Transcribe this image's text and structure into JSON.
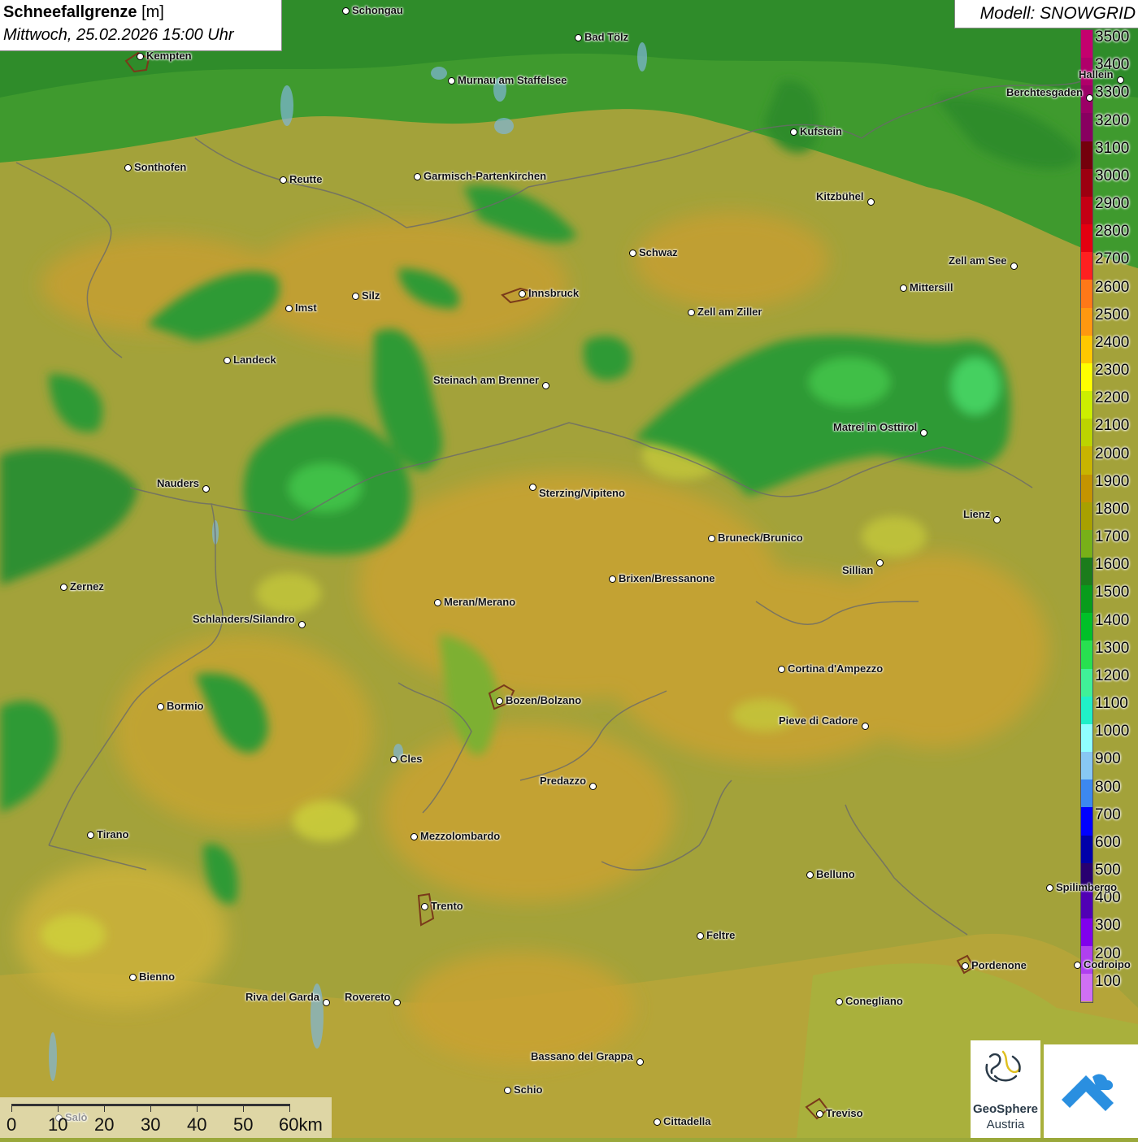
{
  "title": {
    "main": "Schneefallgrenze",
    "unit": "[m]",
    "datetime": "Mittwoch, 25.02.2026 15:00 Uhr"
  },
  "model": "Modell: SNOWGRID",
  "legend": {
    "steps": [
      {
        "label": "3500",
        "color": "#c4006e"
      },
      {
        "label": "3400",
        "color": "#b0006a"
      },
      {
        "label": "3300",
        "color": "#9c0066"
      },
      {
        "label": "3200",
        "color": "#880060"
      },
      {
        "label": "3100",
        "color": "#74000c"
      },
      {
        "label": "3000",
        "color": "#9c0010"
      },
      {
        "label": "2900",
        "color": "#c40014"
      },
      {
        "label": "2800",
        "color": "#e40010"
      },
      {
        "label": "2700",
        "color": "#ff2020"
      },
      {
        "label": "2600",
        "color": "#ff7818"
      },
      {
        "label": "2500",
        "color": "#ff9810"
      },
      {
        "label": "2400",
        "color": "#ffc800"
      },
      {
        "label": "2300",
        "color": "#ffff00"
      },
      {
        "label": "2200",
        "color": "#ccee00"
      },
      {
        "label": "2100",
        "color": "#bcd400"
      },
      {
        "label": "2000",
        "color": "#c8b400"
      },
      {
        "label": "1900",
        "color": "#c49400"
      },
      {
        "label": "1800",
        "color": "#a8a000"
      },
      {
        "label": "1700",
        "color": "#78b018"
      },
      {
        "label": "1600",
        "color": "#1c7c1c"
      },
      {
        "label": "1500",
        "color": "#089c1c"
      },
      {
        "label": "1400",
        "color": "#00c028"
      },
      {
        "label": "1300",
        "color": "#28e050"
      },
      {
        "label": "1200",
        "color": "#40f098"
      },
      {
        "label": "1100",
        "color": "#20f0c8"
      },
      {
        "label": "1000",
        "color": "#90ffff"
      },
      {
        "label": "900",
        "color": "#88c8f4"
      },
      {
        "label": "800",
        "color": "#3c88f0"
      },
      {
        "label": "700",
        "color": "#0000ff"
      },
      {
        "label": "600",
        "color": "#0000a8"
      },
      {
        "label": "500",
        "color": "#280070"
      },
      {
        "label": "400",
        "color": "#5000b4"
      },
      {
        "label": "300",
        "color": "#8000ec"
      },
      {
        "label": "200",
        "color": "#b040f0"
      },
      {
        "label": "100",
        "color": "#d070f4"
      }
    ]
  },
  "cities": [
    {
      "name": "Schongau"
    },
    {
      "name": "Kempten"
    },
    {
      "name": "Bad Tölz"
    },
    {
      "name": "Murnau am Staffelsee"
    },
    {
      "name": "Hallein"
    },
    {
      "name": "Berchtesgaden"
    },
    {
      "name": "Kufstein"
    },
    {
      "name": "Sonthofen"
    },
    {
      "name": "Reutte"
    },
    {
      "name": "Garmisch-Partenkirchen"
    },
    {
      "name": "Kitzbühel"
    },
    {
      "name": "Schwaz"
    },
    {
      "name": "Zell am See"
    },
    {
      "name": "Innsbruck"
    },
    {
      "name": "Mittersill"
    },
    {
      "name": "Imst"
    },
    {
      "name": "Silz"
    },
    {
      "name": "Zell am Ziller"
    },
    {
      "name": "Landeck"
    },
    {
      "name": "Steinach am Brenner"
    },
    {
      "name": "Matrei in Osttirol"
    },
    {
      "name": "Nauders"
    },
    {
      "name": "Sterzing/Vipiteno"
    },
    {
      "name": "Lienz"
    },
    {
      "name": "Bruneck/Brunico"
    },
    {
      "name": "Sillian"
    },
    {
      "name": "Zernez"
    },
    {
      "name": "Brixen/Bressanone"
    },
    {
      "name": "Meran/Merano"
    },
    {
      "name": "Schlanders/Silandro"
    },
    {
      "name": "Cortina d'Ampezzo"
    },
    {
      "name": "Bozen/Bolzano"
    },
    {
      "name": "Bormio"
    },
    {
      "name": "Pieve di Cadore"
    },
    {
      "name": "Cles"
    },
    {
      "name": "Predazzo"
    },
    {
      "name": "Tirano"
    },
    {
      "name": "Mezzolombardo"
    },
    {
      "name": "Belluno"
    },
    {
      "name": "Spilimbergo"
    },
    {
      "name": "Trento"
    },
    {
      "name": "Feltre"
    },
    {
      "name": "Pordenone"
    },
    {
      "name": "Codroipo"
    },
    {
      "name": "Bienno"
    },
    {
      "name": "Riva del Garda"
    },
    {
      "name": "Rovereto"
    },
    {
      "name": "Conegliano"
    },
    {
      "name": "Bassano del Grappa"
    },
    {
      "name": "Schio"
    },
    {
      "name": "Treviso"
    },
    {
      "name": "Cittadella"
    },
    {
      "name": "Salò"
    }
  ],
  "scale": {
    "labels": [
      "0",
      "10",
      "20",
      "30",
      "40",
      "50",
      "60km"
    ]
  },
  "logos": {
    "geosphere_line1": "GeoSphere",
    "geosphere_line2": "Austria"
  }
}
